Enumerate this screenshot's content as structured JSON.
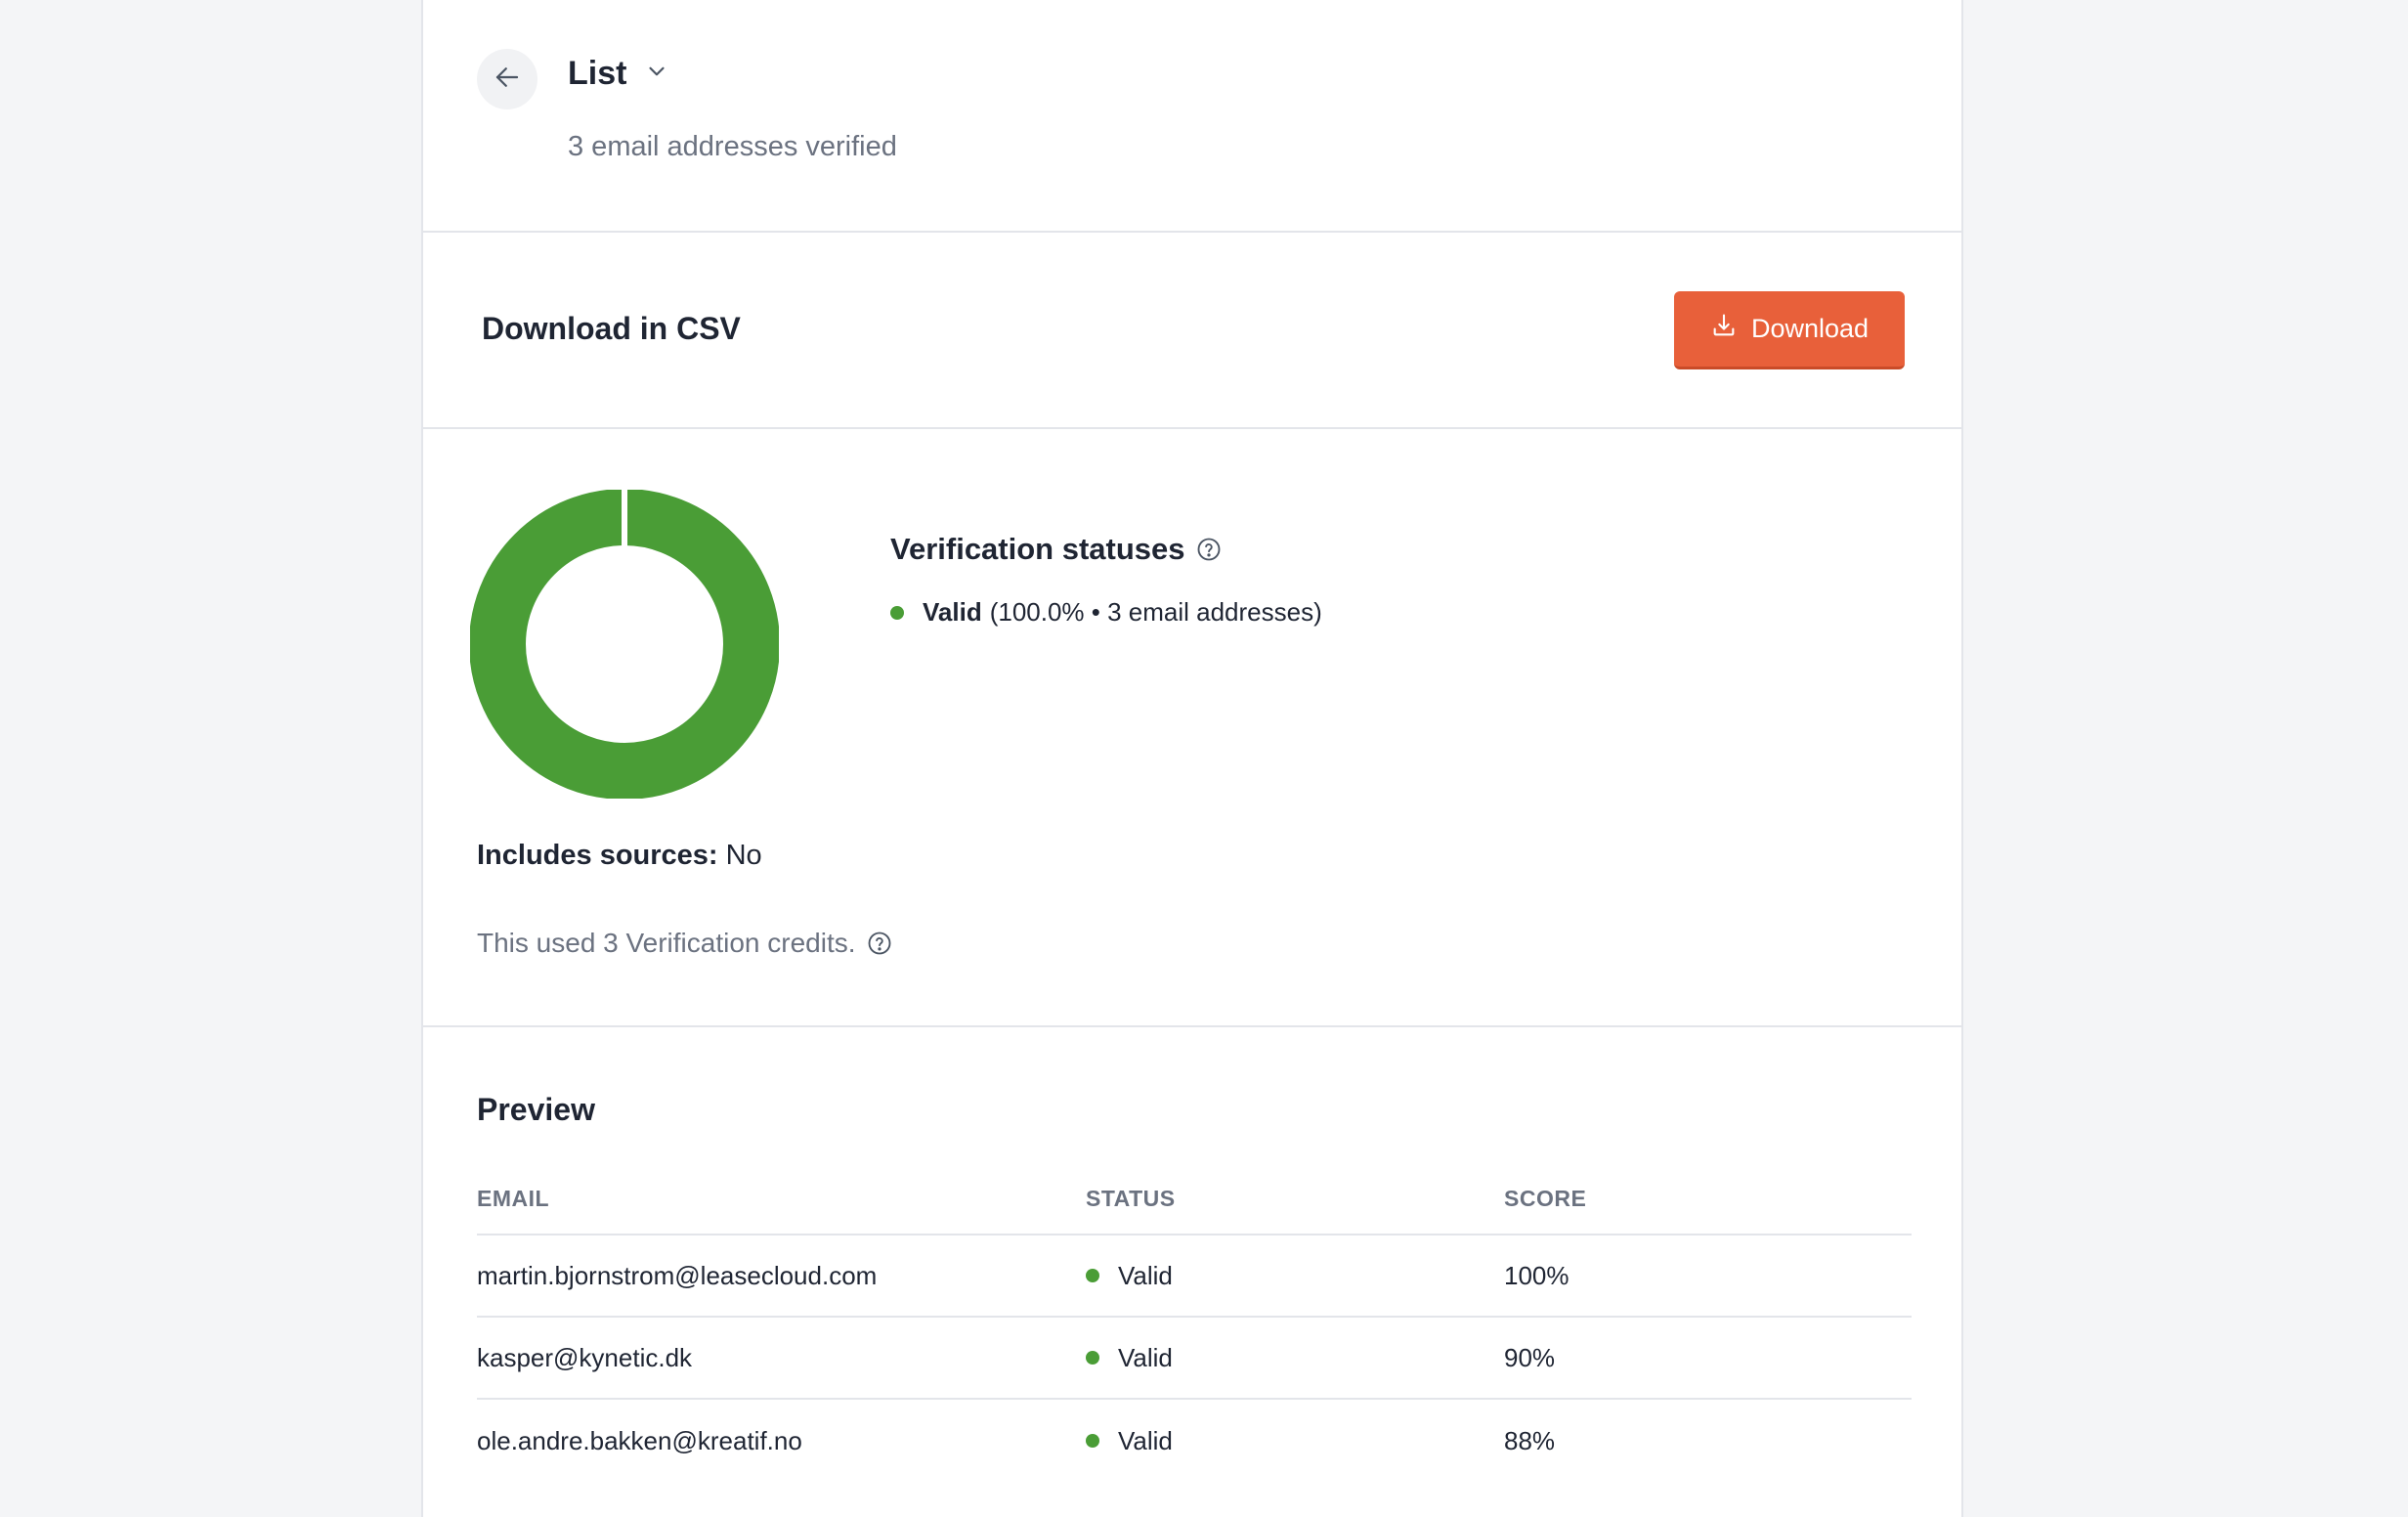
{
  "header": {
    "title": "List",
    "subtitle": "3 email addresses verified"
  },
  "download": {
    "title": "Download in CSV",
    "button_label": "Download"
  },
  "verification": {
    "title": "Verification statuses",
    "legend": [
      {
        "label": "Valid",
        "detail": "(100.0% • 3 email addresses)",
        "color": "#4a9d36"
      }
    ],
    "includes_sources_label": "Includes sources:",
    "includes_sources_value": "No",
    "credits_text": "This used 3 Verification credits."
  },
  "chart_data": {
    "type": "pie",
    "categories": [
      "Valid"
    ],
    "values": [
      100.0
    ],
    "colors": [
      "#4a9d36"
    ]
  },
  "preview": {
    "title": "Preview",
    "columns": [
      "EMAIL",
      "STATUS",
      "SCORE"
    ],
    "rows": [
      {
        "email": "martin.bjornstrom@leasecloud.com",
        "status": "Valid",
        "score": "100%"
      },
      {
        "email": "kasper@kynetic.dk",
        "status": "Valid",
        "score": "90%"
      },
      {
        "email": "ole.andre.bakken@kreatif.no",
        "status": "Valid",
        "score": "88%"
      }
    ]
  },
  "icons": {
    "back": "arrow-left-icon",
    "title_dropdown": "chevron-down-icon",
    "download": "download-icon",
    "help": "question-circle-icon"
  },
  "colors": {
    "accent": "#e8603a",
    "valid": "#4a9d36",
    "muted_text": "#6b7280"
  }
}
